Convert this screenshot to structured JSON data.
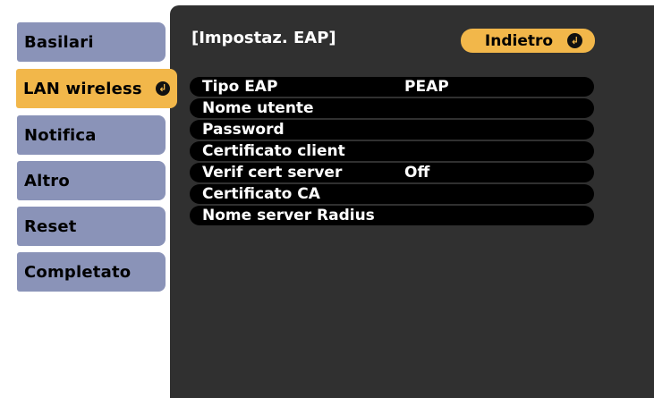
{
  "sidebar": {
    "items": [
      {
        "label": "Basilari"
      },
      {
        "label": "LAN wireless"
      },
      {
        "label": "Notifica"
      },
      {
        "label": "Altro"
      },
      {
        "label": "Reset"
      },
      {
        "label": "Completato"
      }
    ],
    "active_index": 1
  },
  "panel": {
    "title": "[Impostaz. EAP]",
    "back_label": "Indietro",
    "rows": [
      {
        "label": "Tipo EAP",
        "value": "PEAP"
      },
      {
        "label": "Nome utente",
        "value": ""
      },
      {
        "label": "Password",
        "value": ""
      },
      {
        "label": "Certificato client",
        "value": ""
      },
      {
        "label": "Verif cert server",
        "value": "Off"
      },
      {
        "label": "Certificato CA",
        "value": ""
      },
      {
        "label": "Nome server Radius",
        "value": ""
      }
    ]
  },
  "colors": {
    "sidebar_item": "#8a93b8",
    "active_accent": "#f2b74a",
    "panel_bg": "#303030",
    "row_bg": "#000000"
  },
  "icons": {
    "enter": "enter-icon"
  }
}
